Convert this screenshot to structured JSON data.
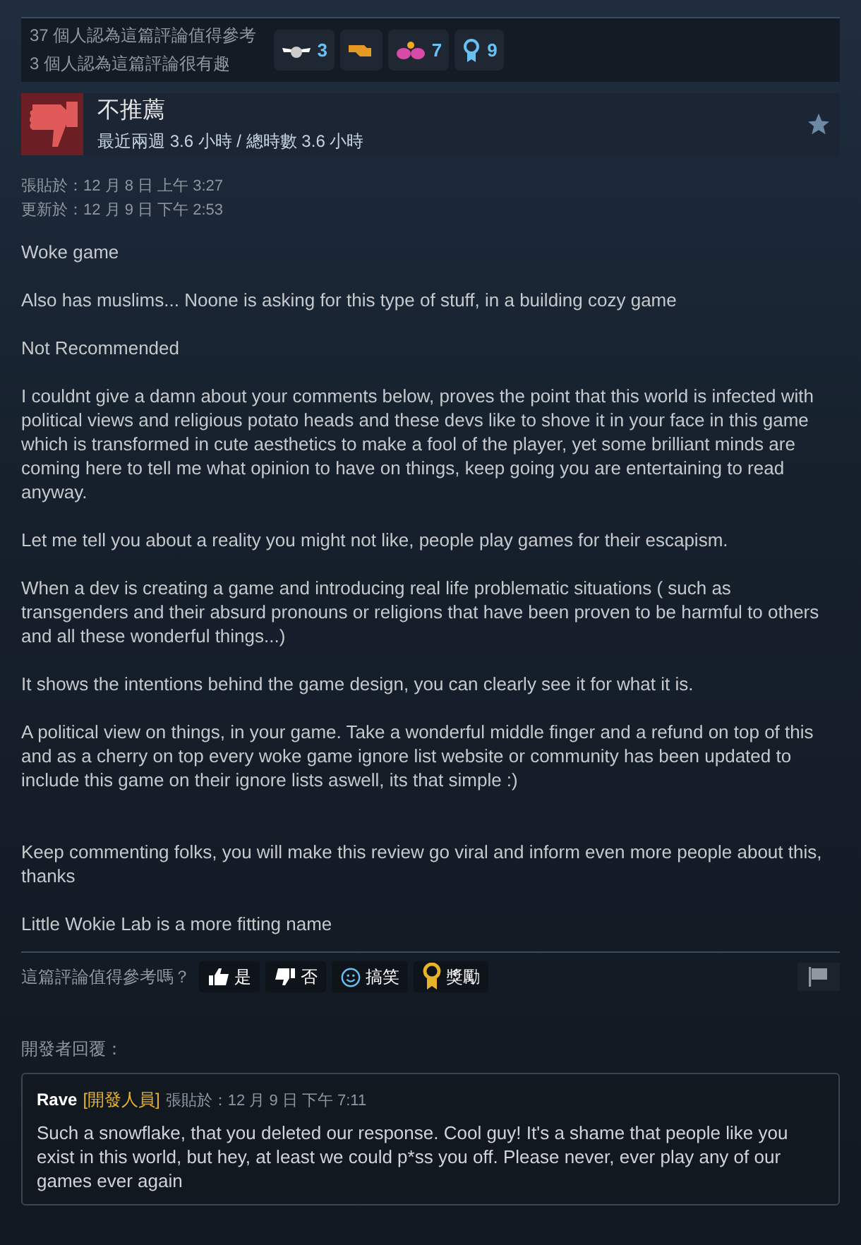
{
  "helpful_summary": [
    "37 個人認為這篇評論值得參考",
    "3 個人認為這篇評論很有趣"
  ],
  "awards": [
    {
      "kind": "wings",
      "count": "3"
    },
    {
      "kind": "hand"
    },
    {
      "kind": "hearts",
      "count": "7"
    },
    {
      "kind": "ribbon",
      "count": "9"
    }
  ],
  "review": {
    "recommended": false,
    "verdict": "不推薦",
    "playtime": "最近兩週 3.6 小時 / 總時數 3.6 小時",
    "posted": "張貼於：12 月 8 日 上午 3:27",
    "updated": "更新於：12 月 9 日 下午 2:53",
    "paragraphs": [
      "Woke game",
      "Also has muslims... Noone is asking for this type of stuff, in a building cozy game",
      "Not Recommended",
      "I couldnt give a damn about your comments below, proves the point that this world is infected with political views and religious potato heads and these devs like to shove it in your face in this game which is transformed in cute aesthetics to make a fool of the player, yet some brilliant minds are coming here to tell me what opinion to have on things, keep going you are entertaining to read anyway.",
      "Let me tell you about a reality you might not like, people play games for their escapism.",
      "When a dev is creating a game and introducing real life problematic situations ( such as transgenders and their absurd pronouns or religions that have been proven to be harmful to others and all these wonderful things...)",
      "It shows the intentions behind the game design, you can clearly see it for what it is.",
      "A political view on things, in your game. Take a wonderful middle finger and a refund on top of this and as a cherry on top every woke game ignore list website or community has been updated to include this game on their ignore lists aswell, its that simple :)",
      "Keep commenting folks, you will make this review go viral and inform even more people about this, thanks",
      "Little Wokie Lab is a more fitting name"
    ]
  },
  "vote": {
    "prompt": "這篇評論值得參考嗎？",
    "buttons": [
      {
        "kind": "yes",
        "label": "是"
      },
      {
        "kind": "no",
        "label": "否"
      },
      {
        "kind": "funny",
        "label": "搞笑"
      },
      {
        "kind": "award",
        "label": "獎勵"
      }
    ]
  },
  "developer_response": {
    "heading": "開發者回覆：",
    "author": "Rave",
    "role": "[開發人員]",
    "posted": "張貼於：12 月 9 日 下午 7:11",
    "text": "Such a snowflake, that you deleted our response. Cool guy! It's a shame that people like you exist in this world, but hey, at least we could p*ss you off. Please never, ever play any of our games ever again"
  }
}
